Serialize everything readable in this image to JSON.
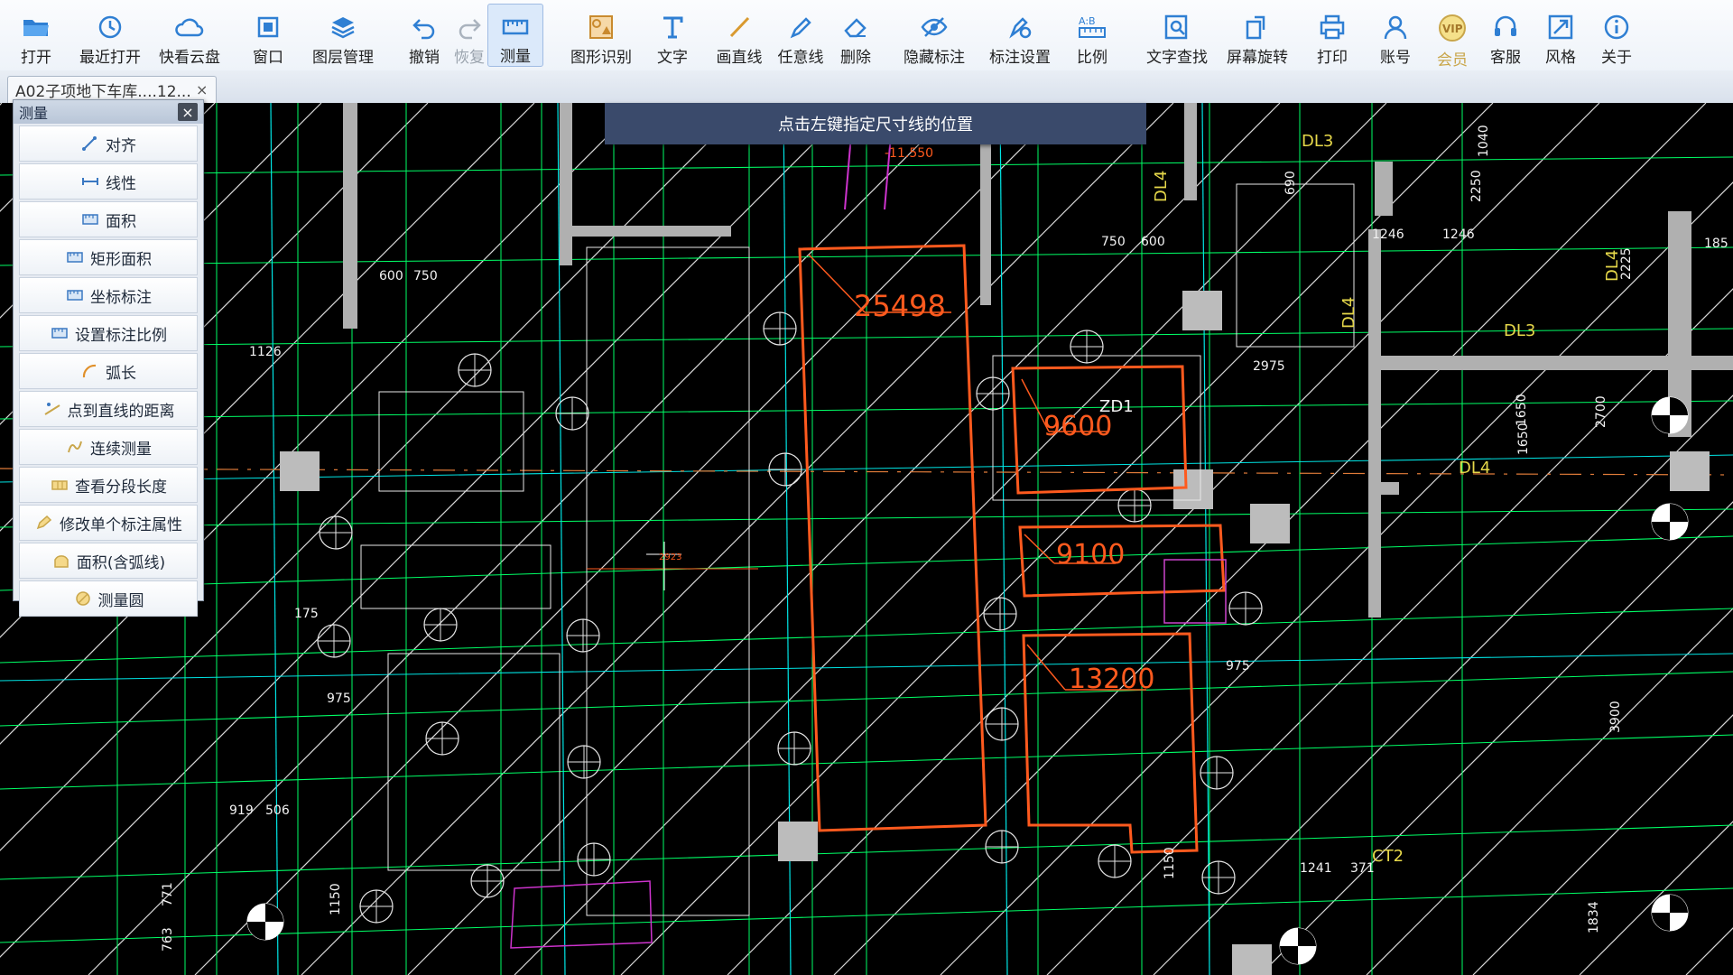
{
  "toolbar": {
    "items": [
      {
        "label": "打开",
        "icon": "open-folder-icon"
      },
      {
        "label": "最近打开",
        "icon": "recent-icon"
      },
      {
        "label": "快看云盘",
        "icon": "cloud-icon"
      },
      {
        "label": "窗口",
        "icon": "window-icon"
      },
      {
        "label": "图层管理",
        "icon": "layers-icon"
      },
      {
        "label": "撤销",
        "icon": "undo-icon"
      },
      {
        "label": "恢复",
        "icon": "redo-icon"
      },
      {
        "label": "测量",
        "icon": "measure-icon"
      },
      {
        "label": "图形识别",
        "icon": "shape-recognize-icon"
      },
      {
        "label": "文字",
        "icon": "text-icon"
      },
      {
        "label": "画直线",
        "icon": "line-icon"
      },
      {
        "label": "任意线",
        "icon": "freehand-icon"
      },
      {
        "label": "删除",
        "icon": "eraser-icon"
      },
      {
        "label": "隐藏标注",
        "icon": "hide-icon"
      },
      {
        "label": "标注设置",
        "icon": "annotation-settings-icon"
      },
      {
        "label": "比例",
        "icon": "ratio-icon"
      },
      {
        "label": "文字查找",
        "icon": "text-search-icon"
      },
      {
        "label": "屏幕旋转",
        "icon": "rotate-icon"
      },
      {
        "label": "打印",
        "icon": "print-icon"
      },
      {
        "label": "账号",
        "icon": "account-icon"
      },
      {
        "label": "会员",
        "icon": "vip-icon"
      },
      {
        "label": "客服",
        "icon": "headset-icon"
      },
      {
        "label": "风格",
        "icon": "style-icon"
      },
      {
        "label": "关于",
        "icon": "info-icon"
      }
    ],
    "active": "测量",
    "disabled": [
      "恢复"
    ]
  },
  "tab": {
    "title": "A02子项地下车库....12...",
    "close": "×"
  },
  "hint": "点击左键指定尺寸线的位置",
  "panel": {
    "title": "测量",
    "close": "×",
    "items": [
      {
        "label": "对齐",
        "icon": "align-icon"
      },
      {
        "label": "线性",
        "icon": "linear-icon"
      },
      {
        "label": "面积",
        "icon": "area-icon"
      },
      {
        "label": "矩形面积",
        "icon": "rect-area-icon"
      },
      {
        "label": "坐标标注",
        "icon": "coordinate-icon"
      },
      {
        "label": "设置标注比例",
        "icon": "scale-icon"
      },
      {
        "label": "弧长",
        "icon": "arc-icon"
      },
      {
        "label": "点到直线的距离",
        "icon": "point-line-icon"
      },
      {
        "label": "连续测量",
        "icon": "continuous-icon"
      },
      {
        "label": "查看分段长度",
        "icon": "segment-icon"
      },
      {
        "label": "修改单个标注属性",
        "icon": "edit-annotation-icon"
      },
      {
        "label": "面积(含弧线)",
        "icon": "arc-area-icon"
      },
      {
        "label": "测量圆",
        "icon": "circle-icon"
      }
    ]
  },
  "drawing": {
    "measures": [
      "25498",
      "9600",
      "9100",
      "13200"
    ],
    "dims": [
      "600",
      "750",
      "750",
      "600",
      "1126",
      "2975",
      "1650",
      "2700",
      "1246",
      "1246",
      "175",
      "975",
      "975",
      "919",
      "506",
      "1150",
      "1150",
      "1241",
      "371",
      "763",
      "771",
      "3900",
      "1650",
      "-11.550",
      "2923",
      "2225",
      "1834",
      "2250",
      "185",
      "690",
      "1040"
    ],
    "labels": [
      "DL3",
      "DL4",
      "DL4",
      "DL3",
      "DL4",
      "DL4",
      "ZD1",
      "CT2"
    ],
    "colors": {
      "measure": "#ff5a1e",
      "grid": "#00ff66",
      "line": "#ffffff",
      "cyan": "#00e5e5",
      "magenta": "#cc33cc",
      "yellow": "#e6d84a"
    }
  }
}
